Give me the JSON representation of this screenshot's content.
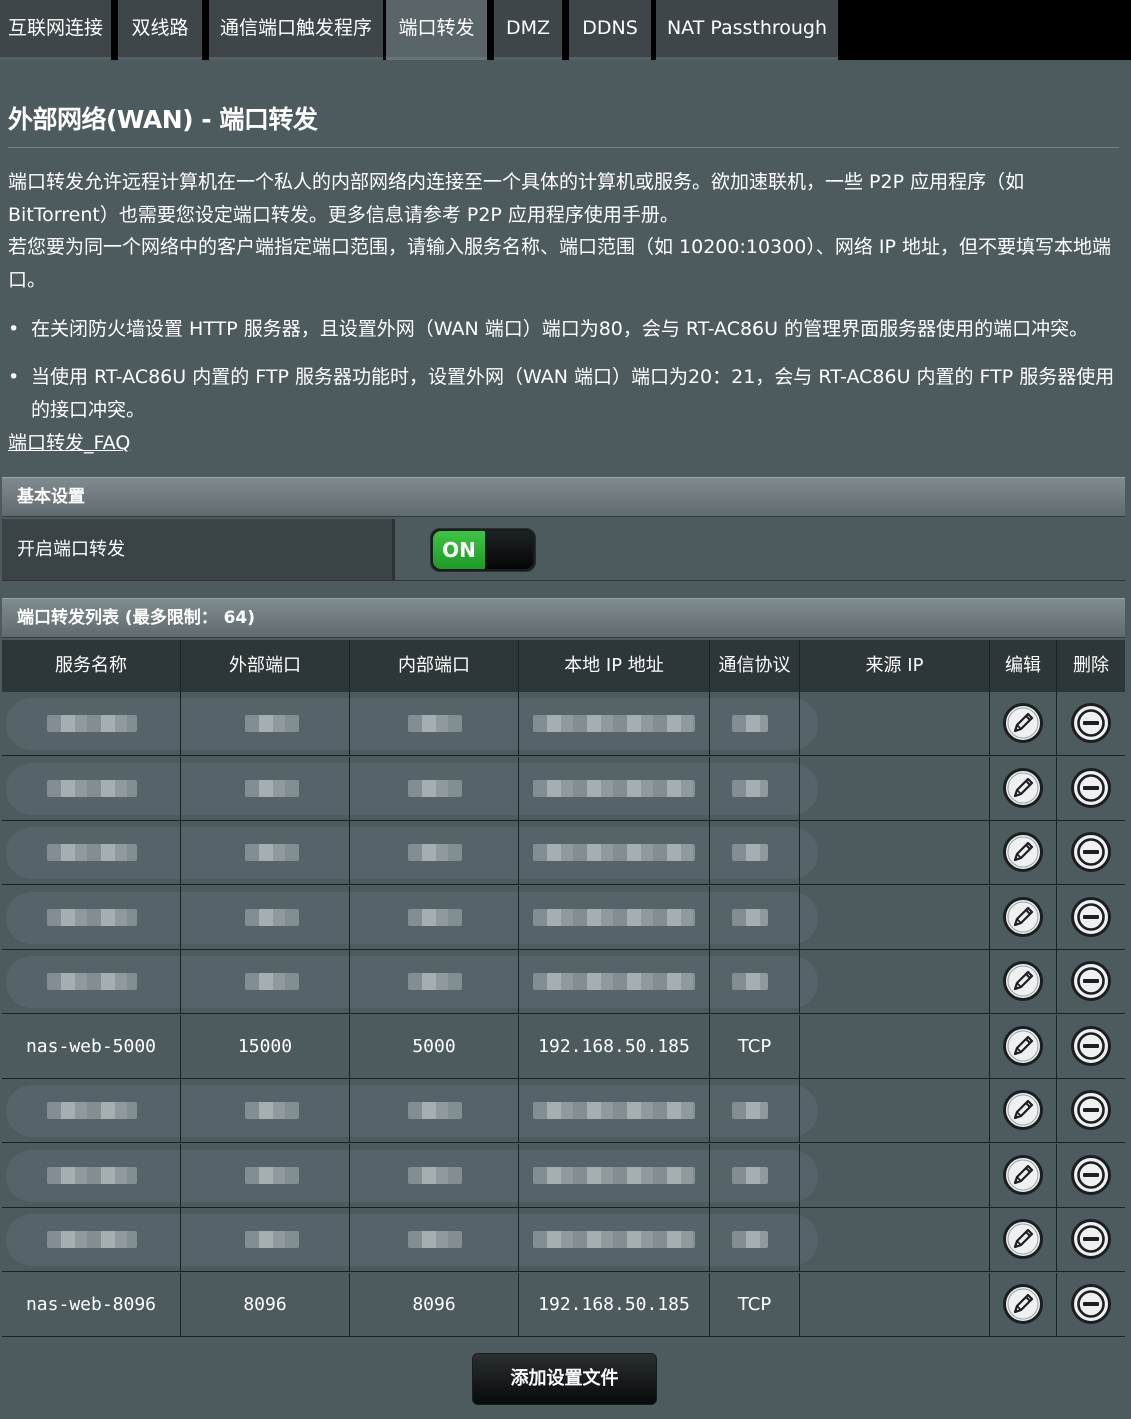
{
  "tabs": [
    {
      "label": "互联网连接",
      "active": false
    },
    {
      "label": "双线路",
      "active": false
    },
    {
      "label": "通信端口触发程序",
      "active": false
    },
    {
      "label": "端口转发",
      "active": true
    },
    {
      "label": "DMZ",
      "active": false
    },
    {
      "label": "DDNS",
      "active": false
    },
    {
      "label": "NAT Passthrough",
      "active": false
    }
  ],
  "page": {
    "title": "外部网络(WAN) - 端口转发",
    "para1": "端口转发允许远程计算机在一个私人的内部网络内连接至一个具体的计算机或服务。欲加速联机，一些 P2P 应用程序（如 BitTorrent）也需要您设定端口转发。更多信息请参考 P2P 应用程序使用手册。",
    "para2": "若您要为同一个网络中的客户端指定端口范围，请输入服务名称、端口范围（如 10200:10300）、网络 IP 地址，但不要填写本地端口。",
    "bullet1": "在关闭防火墙设置 HTTP 服务器，且设置外网（WAN 端口）端口为80，会与 RT-AC86U 的管理界面服务器使用的端口冲突。",
    "bullet2": "当使用 RT-AC86U 内置的 FTP 服务器功能时，设置外网（WAN 端口）端口为20：21，会与 RT-AC86U 内置的 FTP 服务器使用的接口冲突。",
    "faq_link": "端口转发_FAQ",
    "bullet_char": "•"
  },
  "basic": {
    "header": "基本设置",
    "enable_label": "开启端口转发",
    "toggle_text": "ON",
    "toggle_on": true
  },
  "list": {
    "header": "端口转发列表 (最多限制： 64)",
    "columns": [
      "服务名称",
      "外部端口",
      "内部端口",
      "本地 IP 地址",
      "通信协议",
      "来源 IP",
      "编辑",
      "删除"
    ],
    "rows": [
      {
        "service": "",
        "ext": "",
        "int": "",
        "ip": "",
        "proto": "",
        "src": "",
        "redacted": true
      },
      {
        "service": "",
        "ext": "",
        "int": "",
        "ip": "",
        "proto": "",
        "src": "",
        "redacted": true
      },
      {
        "service": "",
        "ext": "",
        "int": "",
        "ip": "",
        "proto": "",
        "src": "",
        "redacted": true
      },
      {
        "service": "",
        "ext": "",
        "int": "",
        "ip": "",
        "proto": "",
        "src": "",
        "redacted": true
      },
      {
        "service": "",
        "ext": "",
        "int": "",
        "ip": "",
        "proto": "",
        "src": "",
        "redacted": true
      },
      {
        "service": "nas-web-5000",
        "ext": "15000",
        "int": "5000",
        "ip": "192.168.50.185",
        "proto": "TCP",
        "src": "",
        "redacted": false
      },
      {
        "service": "",
        "ext": "",
        "int": "",
        "ip": "",
        "proto": "",
        "src": "",
        "redacted": true
      },
      {
        "service": "",
        "ext": "",
        "int": "",
        "ip": "",
        "proto": "",
        "src": "",
        "redacted": true
      },
      {
        "service": "",
        "ext": "",
        "int": "",
        "ip": "",
        "proto": "",
        "src": "",
        "redacted": true
      },
      {
        "service": "nas-web-8096",
        "ext": "8096",
        "int": "8096",
        "ip": "192.168.50.185",
        "proto": "TCP",
        "src": "",
        "redacted": false
      }
    ],
    "edit_icon": "pencil-icon",
    "delete_icon": "minus-circle-icon"
  },
  "add_button": "添加设置文件",
  "colors": {
    "background": "#4d5a5e",
    "toggle_on": "#2fae37",
    "tab_bar": "#000000"
  }
}
